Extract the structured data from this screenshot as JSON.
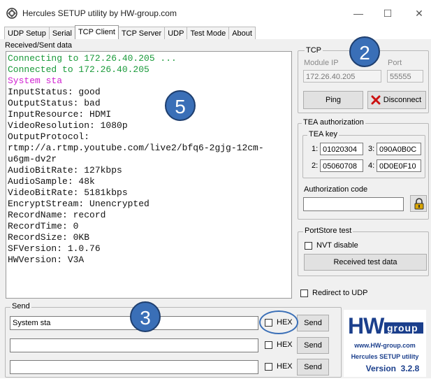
{
  "window": {
    "title": "Hercules SETUP utility by HW-group.com",
    "minimize": "—",
    "maximize": "☐",
    "close": "✕"
  },
  "tabs": [
    "UDP Setup",
    "Serial",
    "TCP Client",
    "TCP Server",
    "UDP",
    "Test Mode",
    "About"
  ],
  "received": {
    "label": "Received/Sent data",
    "lines": [
      {
        "text": "Connecting to 172.26.40.205 ...",
        "color": "green"
      },
      {
        "text": "Connected to 172.26.40.205",
        "color": "green"
      },
      {
        "text": "System sta",
        "color": "magenta"
      },
      {
        "text": "InputStatus: good",
        "color": "black"
      },
      {
        "text": "OutputStatus: bad",
        "color": "black"
      },
      {
        "text": "InputResource: HDMI",
        "color": "black"
      },
      {
        "text": "VideoResolution: 1080p",
        "color": "black"
      },
      {
        "text": "OutputProtocol:",
        "color": "black"
      },
      {
        "text": "rtmp://a.rtmp.youtube.com/live2/bfq6-2gjg-12cm-",
        "color": "black"
      },
      {
        "text": "u6gm-dv2r",
        "color": "black"
      },
      {
        "text": "AudioBitRate: 127kbps",
        "color": "black"
      },
      {
        "text": "AudioSample: 48k",
        "color": "black"
      },
      {
        "text": "VideoBitRate: 5181kbps",
        "color": "black"
      },
      {
        "text": "EncryptStream: Unencrypted",
        "color": "black"
      },
      {
        "text": "RecordName: record",
        "color": "black"
      },
      {
        "text": "RecordTime: 0",
        "color": "black"
      },
      {
        "text": "RecordSize: 0KB",
        "color": "black"
      },
      {
        "text": "SFVersion: 1.0.76",
        "color": "black"
      },
      {
        "text": "HWVersion: V3A",
        "color": "black"
      }
    ]
  },
  "tcp": {
    "group_label": "TCP",
    "module_ip_label": "Module IP",
    "module_ip_value": "172.26.40.205",
    "port_label": "Port",
    "port_value": "55555",
    "ping_label": "Ping",
    "disconnect_label": "Disconnect"
  },
  "tea": {
    "group_label": "TEA authorization",
    "key_label": "TEA key",
    "keys": [
      {
        "num": "1:",
        "value": "01020304"
      },
      {
        "num": "3:",
        "value": "090A0B0C"
      },
      {
        "num": "2:",
        "value": "05060708"
      },
      {
        "num": "4:",
        "value": "0D0E0F10"
      }
    ],
    "auth_code_label": "Authorization code",
    "auth_code_value": ""
  },
  "portstore": {
    "group_label": "PortStore test",
    "nvt_label": "NVT disable",
    "received_test_label": "Received test data"
  },
  "redirect_label": "Redirect to UDP",
  "send": {
    "group_label": "Send",
    "rows": [
      {
        "value": "System sta",
        "hex_label": "HEX",
        "send_label": "Send"
      },
      {
        "value": "",
        "hex_label": "HEX",
        "send_label": "Send"
      },
      {
        "value": "",
        "hex_label": "HEX",
        "send_label": "Send"
      }
    ]
  },
  "logo": {
    "hw": "HW",
    "group": "group",
    "url": "www.HW-group.com",
    "product": "Hercules SETUP utility",
    "version": "Version  3.2.8"
  },
  "annotations": {
    "badge2": "2",
    "badge3": "3",
    "badge5": "5"
  },
  "colors": {
    "green_text": "#1a9a3a",
    "magenta_text": "#d01fd0",
    "badge_blue": "#3a6fb7",
    "logo_blue": "#1b3f8c",
    "disconnect_red": "#cc1111"
  }
}
